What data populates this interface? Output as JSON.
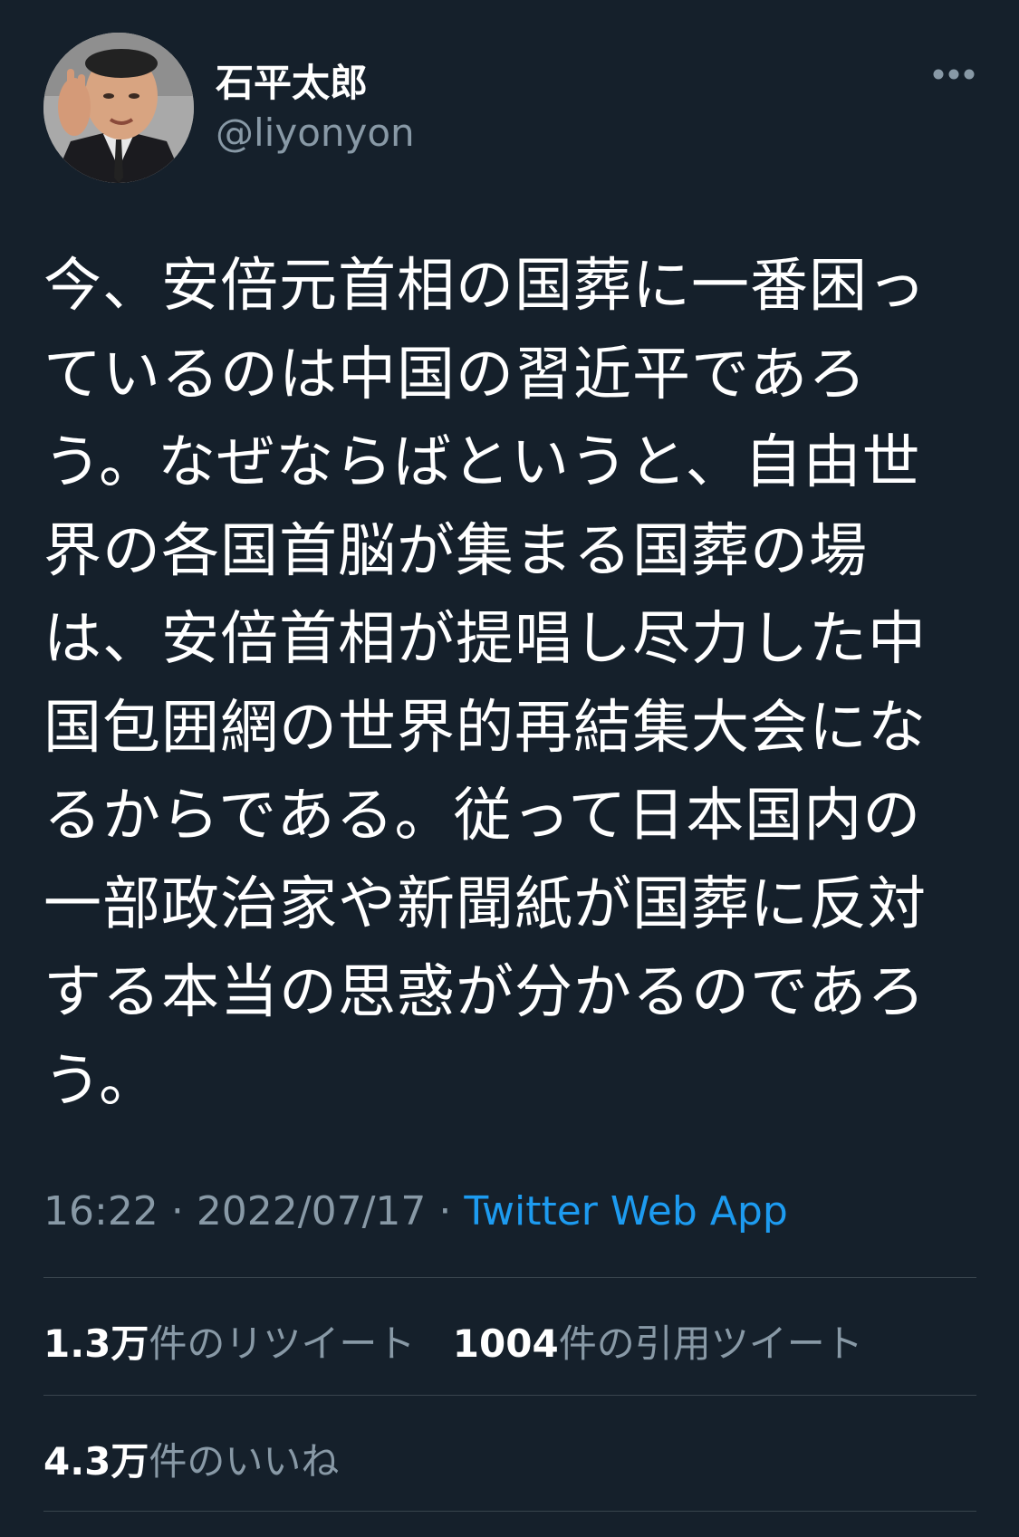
{
  "user": {
    "display_name": "石平太郎",
    "handle": "@liyonyon"
  },
  "tweet": {
    "text": "今、安倍元首相の国葬に一番困っているのは中国の習近平であろう。なぜならばというと、自由世界の各国首脳が集まる国葬の場は、安倍首相が提唱し尽力した中国包囲網の世界的再結集大会になるからである。従って日本国内の一部政治家や新聞紙が国葬に反対する本当の思惑が分かるのであろう。",
    "time": "16:22",
    "date": "2022/07/17",
    "separator": "·",
    "source": "Twitter Web App"
  },
  "stats": {
    "retweets": {
      "count": "1.3万",
      "label": "件のリツイート"
    },
    "quotes": {
      "count": "1004",
      "label": "件の引用ツイート"
    },
    "likes": {
      "count": "4.3万",
      "label": "件のいいね"
    }
  },
  "icons": {
    "more": "more-horizontal-icon",
    "avatar": "avatar"
  },
  "colors": {
    "background": "#15202b",
    "text": "#ffffff",
    "secondary": "#8899a6",
    "link": "#1d9bf0",
    "divider": "#38444d"
  }
}
